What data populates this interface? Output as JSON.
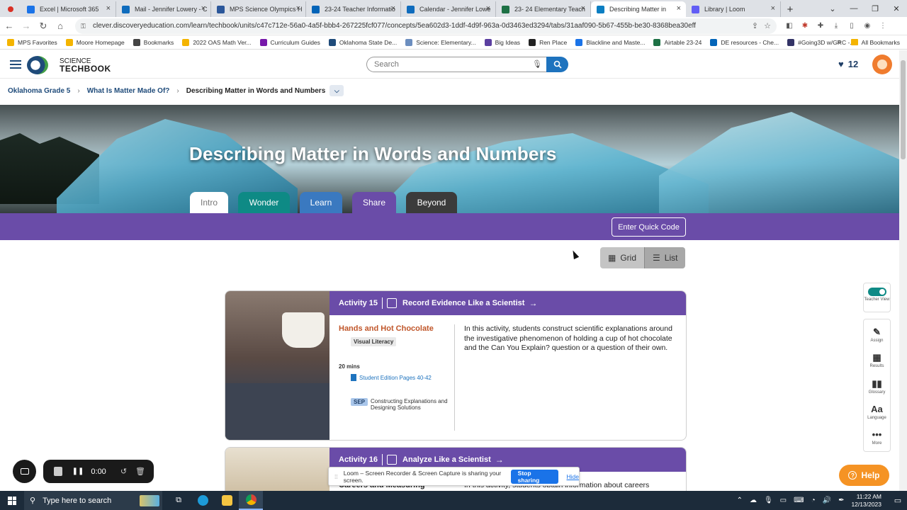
{
  "browser": {
    "tabs": [
      {
        "title": "Excel | Microsoft 365",
        "color": "#1a73e8"
      },
      {
        "title": "Mail - Jennifer Lowery - C",
        "color": "#0f6cbd"
      },
      {
        "title": "MPS Science Olympics H",
        "color": "#2b579a"
      },
      {
        "title": "23-24 Teacher Informatio",
        "color": "#0364b8"
      },
      {
        "title": "Calendar - Jennifer Lowe",
        "color": "#0f6cbd"
      },
      {
        "title": "23- 24 Elementary Teach",
        "color": "#1e7145"
      },
      {
        "title": "Describing Matter in",
        "color": "#0b7ec2",
        "active": true
      },
      {
        "title": "Library | Loom",
        "color": "#625df5"
      }
    ],
    "url": "clever.discoveryeducation.com/learn/techbook/units/c47c712e-56a0-4a5f-bbb4-267225fcf077/concepts/5ea602d3-1ddf-4d9f-963a-0d3463ed3294/tabs/31aaf090-5b67-455b-be30-8368bea30eff",
    "bookmarks": [
      {
        "label": "MPS Favorites",
        "color": "#f4b400"
      },
      {
        "label": "Moore Homepage",
        "color": "#f4b400"
      },
      {
        "label": "Bookmarks",
        "color": "#444444"
      },
      {
        "label": "2022 OAS Math Ver...",
        "color": "#f4b400"
      },
      {
        "label": "Curriculum Guides",
        "color": "#7719aa"
      },
      {
        "label": "Oklahoma State De...",
        "color": "#1f4b7a"
      },
      {
        "label": "Science: Elementary...",
        "color": "#6c8ebf"
      },
      {
        "label": "Big Ideas",
        "color": "#5b3fa0"
      },
      {
        "label": "Ren Place",
        "color": "#222222"
      },
      {
        "label": "Blackline and Maste...",
        "color": "#1a73e8"
      },
      {
        "label": "Airtable 23-24",
        "color": "#1e7145"
      },
      {
        "label": "DE resources - Che...",
        "color": "#0364b8"
      },
      {
        "label": "#Going3D w/GRC -...",
        "color": "#333366"
      }
    ],
    "all_bookmarks": "All Bookmarks"
  },
  "header": {
    "logo_line1": "SCIENCE",
    "logo_line2": "TECHBOOK",
    "search_placeholder": "Search",
    "favorites_count": "12"
  },
  "breadcrumb": {
    "items": [
      "Oklahoma Grade 5",
      "What Is Matter Made Of?"
    ],
    "current": "Describing Matter in Words and Numbers"
  },
  "hero": {
    "title": "Describing Matter in Words and Numbers",
    "tabs": [
      "Intro",
      "Wonder",
      "Learn",
      "Share",
      "Beyond"
    ],
    "active_tab": "Share"
  },
  "quick_code_label": "Enter Quick Code",
  "view_toggle": {
    "grid": "Grid",
    "list": "List",
    "selected": "List"
  },
  "activities": [
    {
      "number": "Activity 15",
      "title": "Record Evidence Like a Scientist",
      "topic": "Hands and Hot Chocolate",
      "badge": "Visual Literacy",
      "duration": "20 mins",
      "link": "Student Edition Pages 40-42",
      "sep_tag": "SEP",
      "sep_text": "Constructing Explanations and Designing Solutions",
      "description": "In this activity, students construct scientific explanations around the investigative phenomenon of holding a cup of hot chocolate and the Can You Explain? question or a question of their own."
    },
    {
      "number": "Activity 16",
      "title": "Analyze Like a Scientist",
      "topic": "Careers and Measuring",
      "description": "In this activity, students obtain information about careers"
    }
  ],
  "rail": {
    "teacher_view": "Teacher View",
    "items": [
      {
        "label": "Assign",
        "icon": "assign-icon"
      },
      {
        "label": "Results",
        "icon": "results-icon"
      },
      {
        "label": "Glossary",
        "icon": "glossary-icon"
      },
      {
        "label": "Language",
        "icon": "language-icon",
        "glyph": "Aa"
      },
      {
        "label": "More",
        "icon": "more-icon"
      }
    ]
  },
  "help_label": "Help",
  "loom": {
    "timer": "0:00",
    "share_message": "Loom – Screen Recorder & Screen Capture is sharing your screen.",
    "stop_label": "Stop sharing",
    "hide_label": "Hide"
  },
  "taskbar": {
    "search_placeholder": "Type here to search",
    "time": "11:22 AM",
    "date": "12/13/2023"
  }
}
